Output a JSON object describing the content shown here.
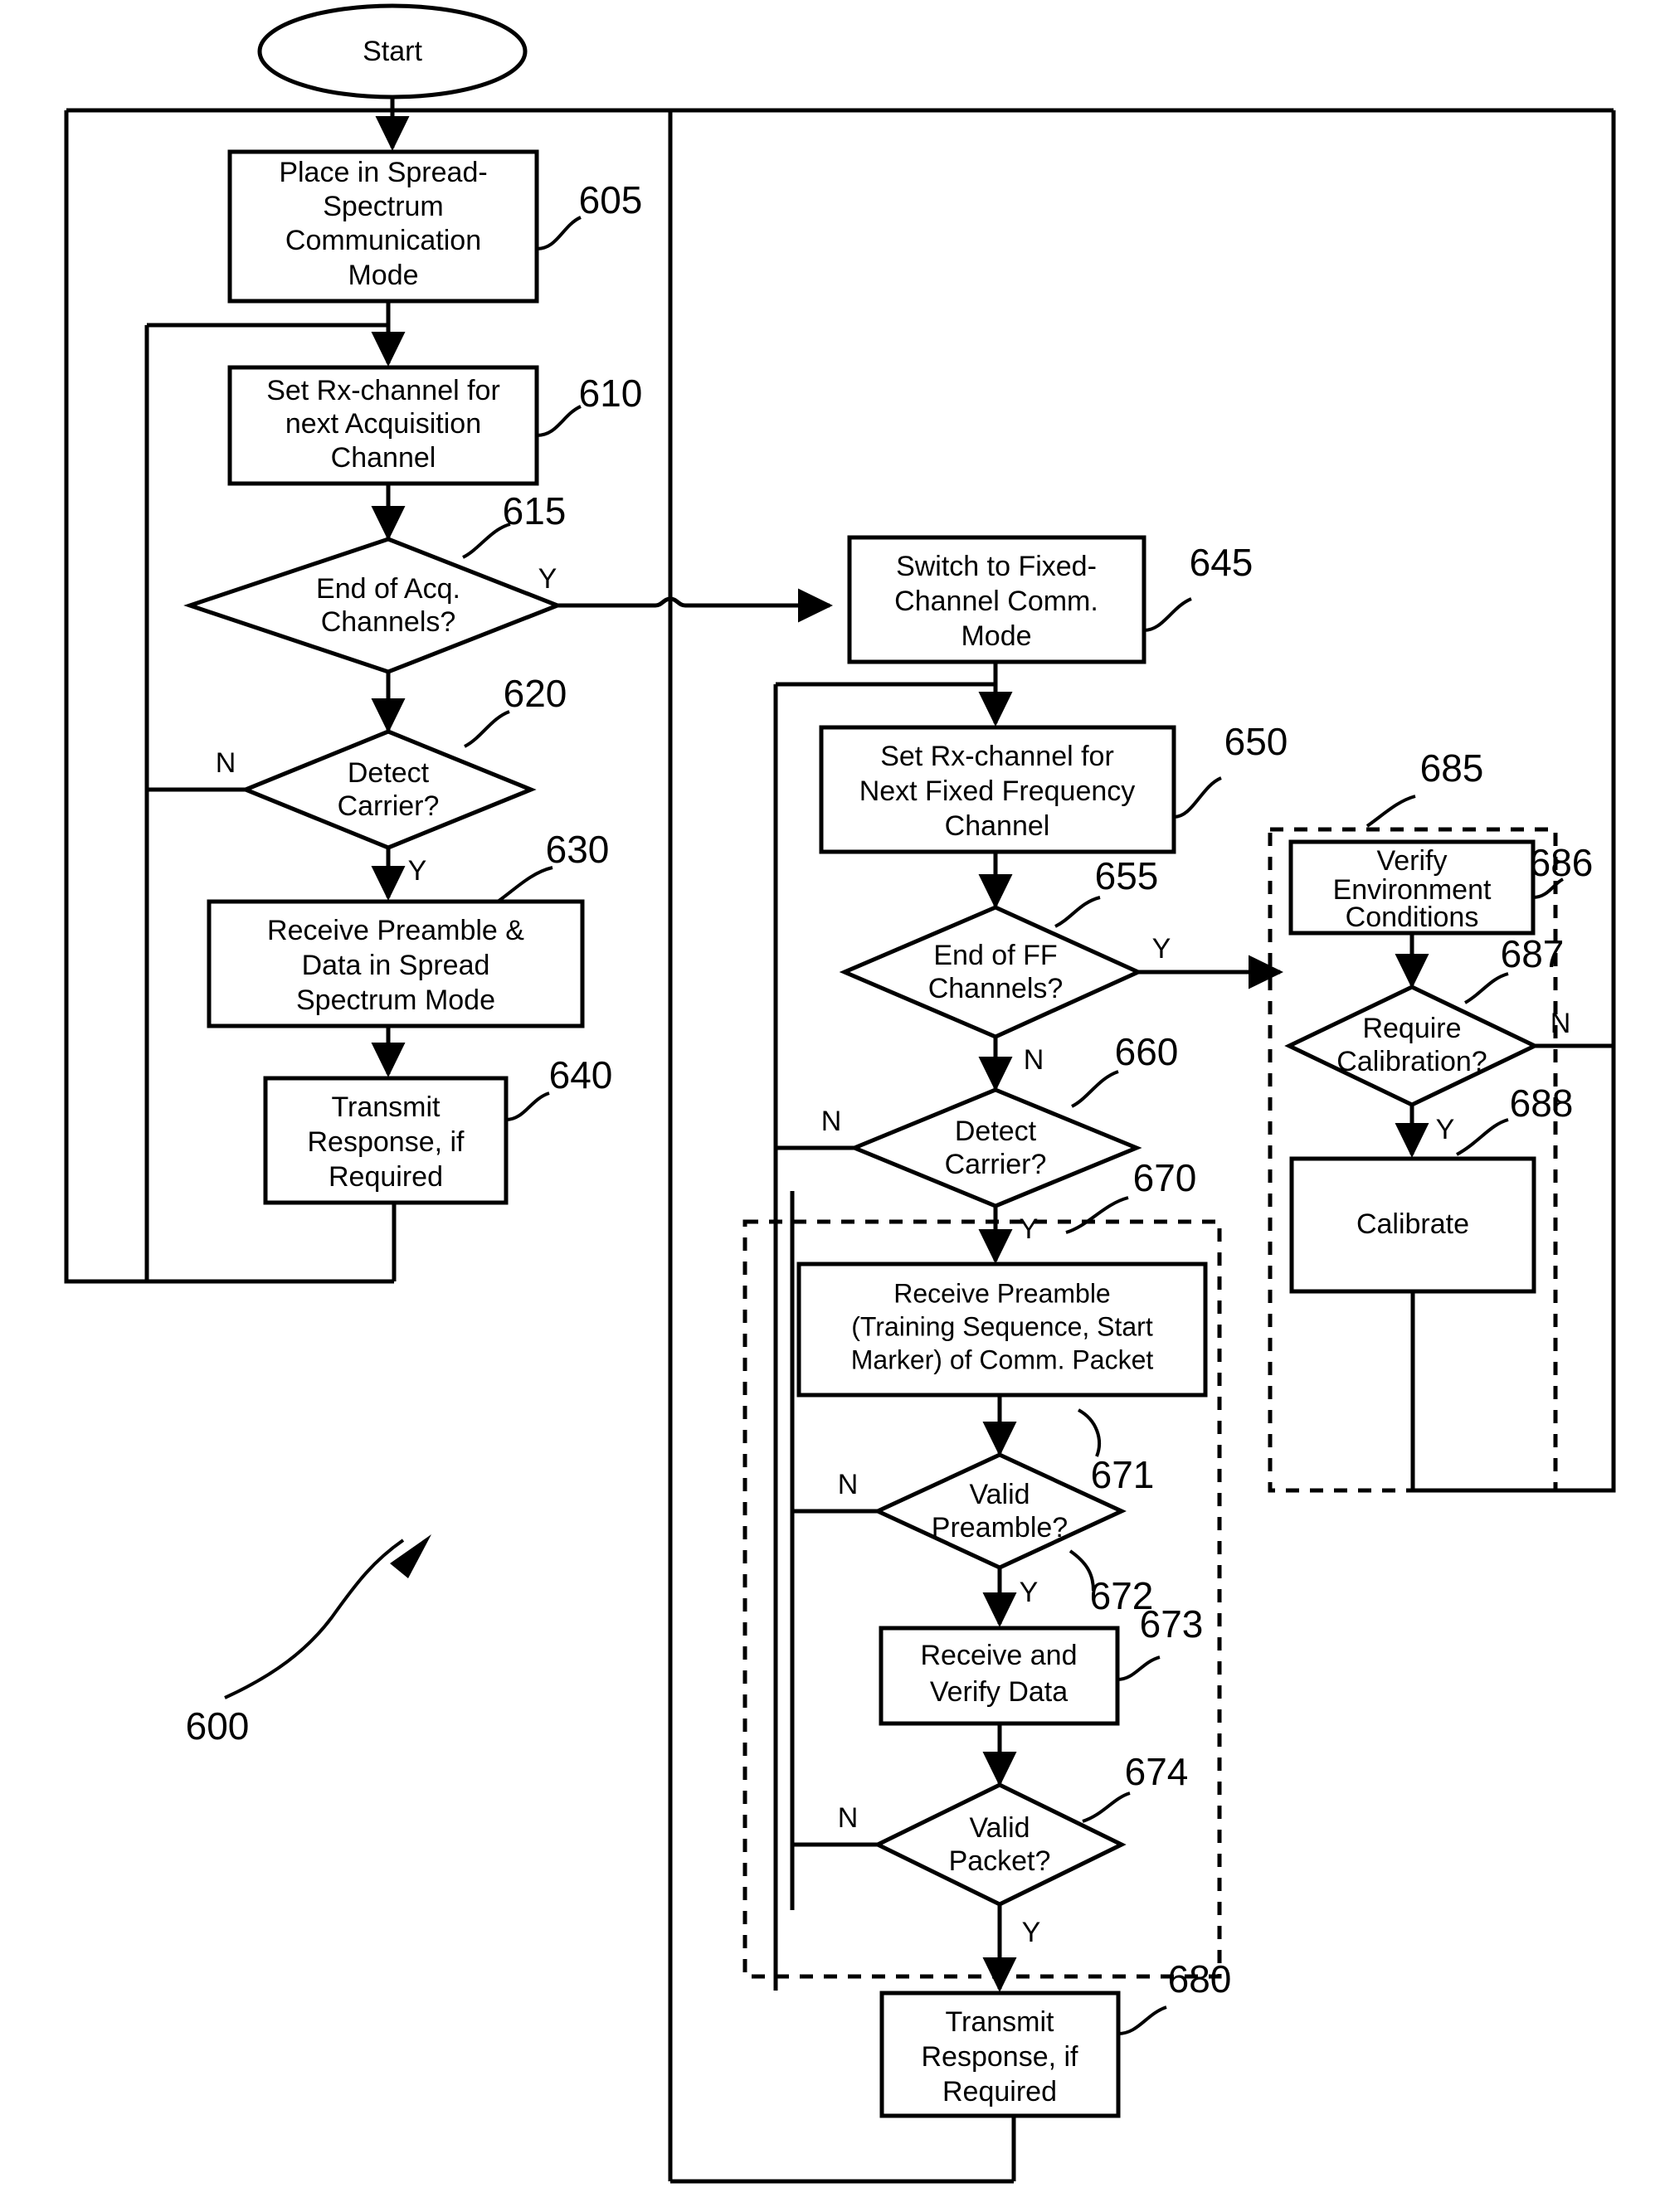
{
  "figure": {
    "reference_numeral": "600",
    "start_label": "Start"
  },
  "nodes": {
    "n605": {
      "ref": "605",
      "lines": [
        "Place in Spread-",
        "Spectrum",
        "Communication",
        "Mode"
      ]
    },
    "n610": {
      "ref": "610",
      "lines": [
        "Set Rx-channel for",
        "next Acquisition",
        "Channel"
      ]
    },
    "n615": {
      "ref": "615",
      "lines": [
        "End of Acq.",
        "Channels?"
      ],
      "yes": "Y"
    },
    "n620": {
      "ref": "620",
      "lines": [
        "Detect",
        "Carrier?"
      ],
      "no": "N",
      "yes": "Y"
    },
    "n630": {
      "ref": "630",
      "lines": [
        "Receive Preamble &",
        "Data in Spread",
        "Spectrum Mode"
      ]
    },
    "n640": {
      "ref": "640",
      "lines": [
        "Transmit",
        "Response, if",
        "Required"
      ]
    },
    "n645": {
      "ref": "645",
      "lines": [
        "Switch to Fixed-",
        "Channel Comm.",
        "Mode"
      ]
    },
    "n650": {
      "ref": "650",
      "lines": [
        "Set Rx-channel for",
        "Next Fixed Frequency",
        "Channel"
      ]
    },
    "n655": {
      "ref": "655",
      "lines": [
        "End of FF",
        "Channels?"
      ],
      "yes": "Y",
      "no": "N"
    },
    "n660": {
      "ref": "660",
      "lines": [
        "Detect",
        "Carrier?"
      ],
      "no": "N",
      "yes": "Y"
    },
    "n670": {
      "ref": "670"
    },
    "n671": {
      "ref": "671",
      "lines": [
        "Receive Preamble",
        "(Training Sequence, Start",
        "Marker) of Comm. Packet"
      ]
    },
    "n672": {
      "ref": "672",
      "lines": [
        "Valid",
        "Preamble?"
      ],
      "no": "N",
      "yes": "Y"
    },
    "n673": {
      "ref": "673",
      "lines": [
        "Receive and",
        "Verify Data"
      ]
    },
    "n674": {
      "ref": "674",
      "lines": [
        "Valid",
        "Packet?"
      ],
      "no": "N",
      "yes": "Y"
    },
    "n680": {
      "ref": "680",
      "lines": [
        "Transmit",
        "Response, if",
        "Required"
      ]
    },
    "n685": {
      "ref": "685"
    },
    "n686": {
      "ref": "686",
      "lines": [
        "Verify",
        "Environment",
        "Conditions"
      ]
    },
    "n687": {
      "ref": "687",
      "lines": [
        "Require",
        "Calibration?"
      ],
      "no": "N",
      "yes": "Y"
    },
    "n688": {
      "ref": "688",
      "lines": [
        "Calibrate"
      ]
    }
  },
  "colors": {
    "ink": "#000000",
    "paper": "#ffffff"
  }
}
